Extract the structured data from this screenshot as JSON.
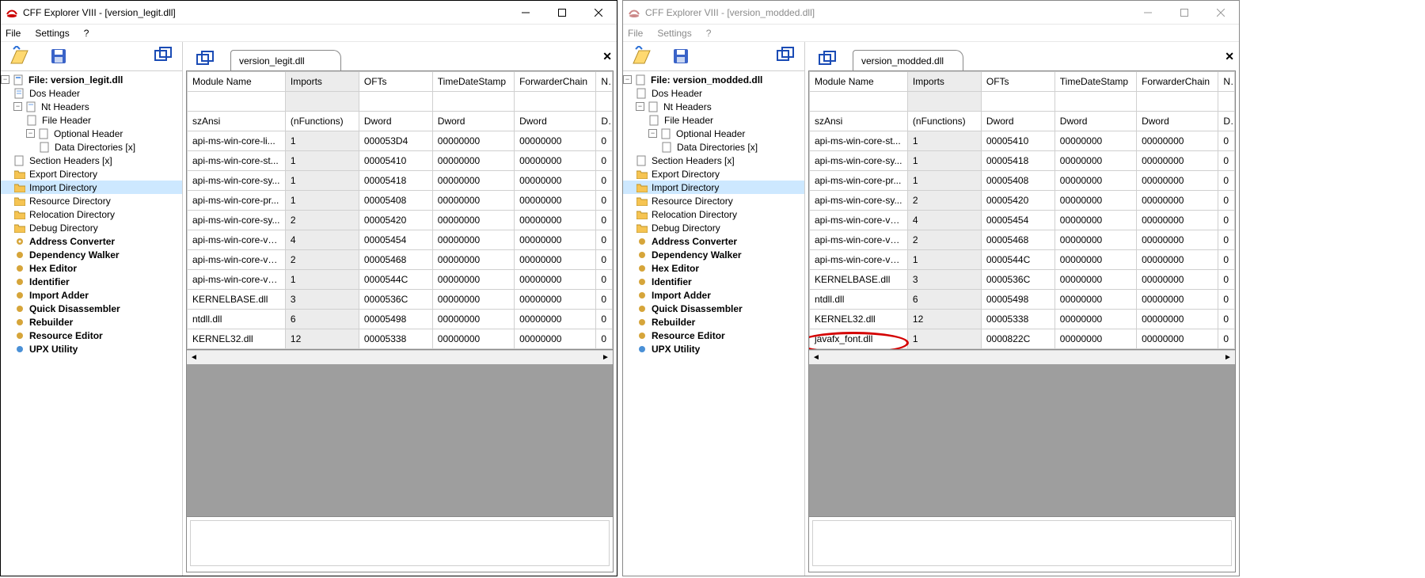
{
  "left": {
    "title": "CFF Explorer VIII - [version_legit.dll]",
    "menus": [
      "File",
      "Settings",
      "?"
    ],
    "filetab": "version_legit.dll",
    "tree_root": "File: version_legit.dll",
    "tree": {
      "dos": "Dos Header",
      "nt": "Nt Headers",
      "fh": "File Header",
      "oh": "Optional Header",
      "dd": "Data Directories [x]",
      "sh": "Section Headers [x]",
      "ed": "Export Directory",
      "id": "Import Directory",
      "rd": "Resource Directory",
      "reld": "Relocation Directory",
      "dbg": "Debug Directory",
      "ac": "Address Converter",
      "dw": "Dependency Walker",
      "he": "Hex Editor",
      "idf": "Identifier",
      "ia": "Import Adder",
      "qd": "Quick Disassembler",
      "rb": "Rebuilder",
      "re": "Resource Editor",
      "upx": "UPX Utility"
    },
    "columns": [
      "Module Name",
      "Imports",
      "OFTs",
      "TimeDateStamp",
      "ForwarderChain",
      "N"
    ],
    "typerow": [
      "szAnsi",
      "(nFunctions)",
      "Dword",
      "Dword",
      "Dword",
      "D"
    ],
    "rows": [
      [
        "api-ms-win-core-li...",
        "1",
        "000053D4",
        "00000000",
        "00000000",
        "0"
      ],
      [
        "api-ms-win-core-st...",
        "1",
        "00005410",
        "00000000",
        "00000000",
        "0"
      ],
      [
        "api-ms-win-core-sy...",
        "1",
        "00005418",
        "00000000",
        "00000000",
        "0"
      ],
      [
        "api-ms-win-core-pr...",
        "1",
        "00005408",
        "00000000",
        "00000000",
        "0"
      ],
      [
        "api-ms-win-core-sy...",
        "2",
        "00005420",
        "00000000",
        "00000000",
        "0"
      ],
      [
        "api-ms-win-core-ve...",
        "4",
        "00005454",
        "00000000",
        "00000000",
        "0"
      ],
      [
        "api-ms-win-core-ve...",
        "2",
        "00005468",
        "00000000",
        "00000000",
        "0"
      ],
      [
        "api-ms-win-core-ve...",
        "1",
        "0000544C",
        "00000000",
        "00000000",
        "0"
      ],
      [
        "KERNELBASE.dll",
        "3",
        "0000536C",
        "00000000",
        "00000000",
        "0"
      ],
      [
        "ntdll.dll",
        "6",
        "00005498",
        "00000000",
        "00000000",
        "0"
      ],
      [
        "KERNEL32.dll",
        "12",
        "00005338",
        "00000000",
        "00000000",
        "0"
      ]
    ]
  },
  "right": {
    "title": "CFF Explorer VIII - [version_modded.dll]",
    "menus": [
      "File",
      "Settings",
      "?"
    ],
    "filetab": "version_modded.dll",
    "tree_root": "File: version_modded.dll",
    "tree": {
      "dos": "Dos Header",
      "nt": "Nt Headers",
      "fh": "File Header",
      "oh": "Optional Header",
      "dd": "Data Directories [x]",
      "sh": "Section Headers [x]",
      "ed": "Export Directory",
      "id": "Import Directory",
      "rd": "Resource Directory",
      "reld": "Relocation Directory",
      "dbg": "Debug Directory",
      "ac": "Address Converter",
      "dw": "Dependency Walker",
      "he": "Hex Editor",
      "idf": "Identifier",
      "ia": "Import Adder",
      "qd": "Quick Disassembler",
      "rb": "Rebuilder",
      "re": "Resource Editor",
      "upx": "UPX Utility"
    },
    "columns": [
      "Module Name",
      "Imports",
      "OFTs",
      "TimeDateStamp",
      "ForwarderChain",
      "N"
    ],
    "typerow": [
      "szAnsi",
      "(nFunctions)",
      "Dword",
      "Dword",
      "Dword",
      "D"
    ],
    "rows": [
      [
        "api-ms-win-core-st...",
        "1",
        "00005410",
        "00000000",
        "00000000",
        "0"
      ],
      [
        "api-ms-win-core-sy...",
        "1",
        "00005418",
        "00000000",
        "00000000",
        "0"
      ],
      [
        "api-ms-win-core-pr...",
        "1",
        "00005408",
        "00000000",
        "00000000",
        "0"
      ],
      [
        "api-ms-win-core-sy...",
        "2",
        "00005420",
        "00000000",
        "00000000",
        "0"
      ],
      [
        "api-ms-win-core-ve...",
        "4",
        "00005454",
        "00000000",
        "00000000",
        "0"
      ],
      [
        "api-ms-win-core-ve...",
        "2",
        "00005468",
        "00000000",
        "00000000",
        "0"
      ],
      [
        "api-ms-win-core-ve...",
        "1",
        "0000544C",
        "00000000",
        "00000000",
        "0"
      ],
      [
        "KERNELBASE.dll",
        "3",
        "0000536C",
        "00000000",
        "00000000",
        "0"
      ],
      [
        "ntdll.dll",
        "6",
        "00005498",
        "00000000",
        "00000000",
        "0"
      ],
      [
        "KERNEL32.dll",
        "12",
        "00005338",
        "00000000",
        "00000000",
        "0"
      ],
      [
        "javafx_font.dll",
        "1",
        "0000822C",
        "00000000",
        "00000000",
        "0"
      ]
    ]
  }
}
